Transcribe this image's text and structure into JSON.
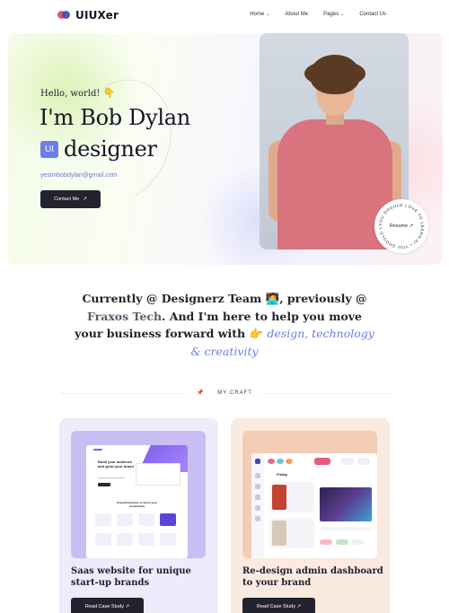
{
  "brand": {
    "name": "UIUXer"
  },
  "nav": {
    "items": [
      {
        "label": "Home",
        "has_dropdown": true
      },
      {
        "label": "About Me",
        "has_dropdown": false
      },
      {
        "label": "Pages",
        "has_dropdown": true
      },
      {
        "label": "Contact Us",
        "has_dropdown": false
      }
    ]
  },
  "hero": {
    "greeting": "Hello, world!",
    "greeting_emoji": "👇",
    "name": "I'm Bob Dylan",
    "role_badge": "UI",
    "role": "designer",
    "email": "yesimbobdylan@gmail.com",
    "contact_button": "Contact Me",
    "contact_button_arrow": "↗",
    "resume_label": "Resume ↗",
    "resume_ring_text": "YOU SHOULD LOVE TO LEARN AI • YOU SHOULD LOVE TO LEARN AI • "
  },
  "intro": {
    "part1": "Currently @ Designerz Team",
    "emoji1": "🧑‍💻",
    "part2": ", previously @",
    "company": "Fraxos Tech",
    "part3": ". And I'm here to help you move your business forward with",
    "emoji2": "👉",
    "accent": "design, technology & creativity"
  },
  "craft": {
    "label": "MY CRAFT",
    "pin": "📌"
  },
  "cards": [
    {
      "title": "Saas website for unique start-up brands",
      "button": "Read Case Study ↗",
      "mock_text": "Build your audience and grow your brand",
      "mock_section": "Powerful features to boost your productivity"
    },
    {
      "title": "Re-design admin dashboard to your brand",
      "button": "Read Case Study ↗",
      "mock_date": "Friday"
    }
  ],
  "colors": {
    "accent": "#6c7ee6",
    "dark": "#23232f",
    "card1_bg": "#eeebfb",
    "card2_bg": "#fbeadf",
    "shirt": "#d9737d"
  }
}
